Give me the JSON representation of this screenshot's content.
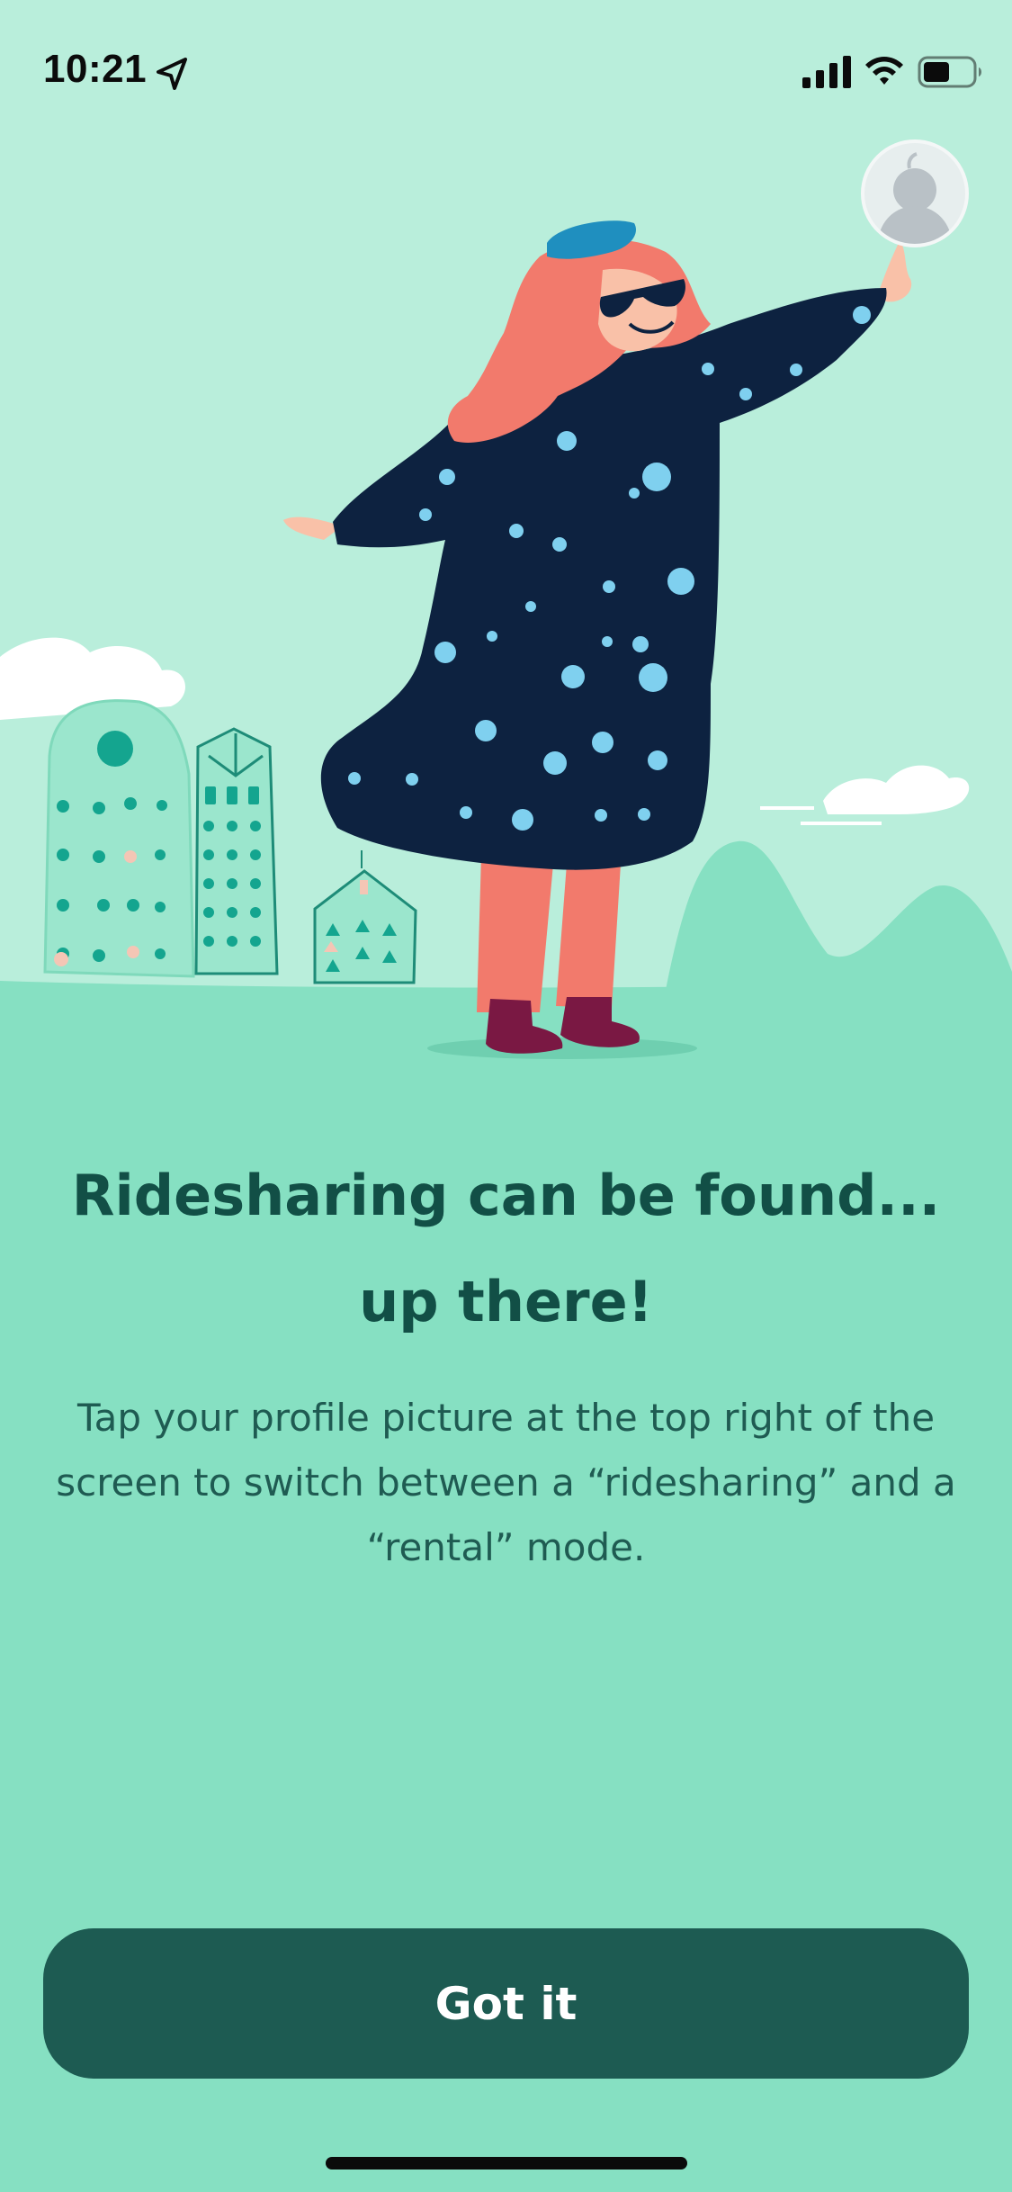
{
  "status_bar": {
    "time": "10:21"
  },
  "icons": {
    "location": "location-arrow-icon",
    "signal": "cellular-signal-icon",
    "wifi": "wifi-icon",
    "battery": "battery-icon",
    "profile": "profile-avatar-icon"
  },
  "onboarding": {
    "headline": "Ridesharing can be found... up there!",
    "body": "Tap your profile picture at the top right of the screen to switch between a “ridesharing” and a “rental” mode.",
    "button_label": "Got it"
  },
  "colors": {
    "background": "#86e0c2",
    "sky": "#b9eedb",
    "button": "#1d5b52",
    "headline": "#124f46"
  }
}
